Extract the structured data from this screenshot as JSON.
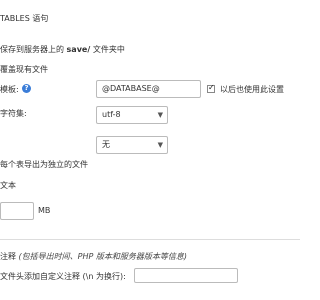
{
  "cut_top_text": "",
  "drop_tables_text": "TABLES 语句",
  "save_on_server": {
    "prefix": "保存到服务器上的 ",
    "dir": "save/",
    "suffix": " 文件夹中"
  },
  "overwrite_label": "覆盖现有文件",
  "template": {
    "label": "模板:",
    "value": "@DATABASE@",
    "remember_label": "以后也使用此设置",
    "remember_checked": true
  },
  "charset": {
    "label": "字符集:",
    "value": "utf-8"
  },
  "compression": {
    "value": "无"
  },
  "separate_files_label": "每个表导出为独立的文件",
  "as_text_label": "文本",
  "size_unit": "MB",
  "comments": {
    "label": "注释",
    "hint": "(包括导出时间、PHP 版本和服务器版本等信息)",
    "custom_label": "文件头添加自定义注释 (\\n 为换行):"
  },
  "colors": {
    "border": "#bbbbbb",
    "accent": "#3b7dd8",
    "text": "#333333"
  }
}
